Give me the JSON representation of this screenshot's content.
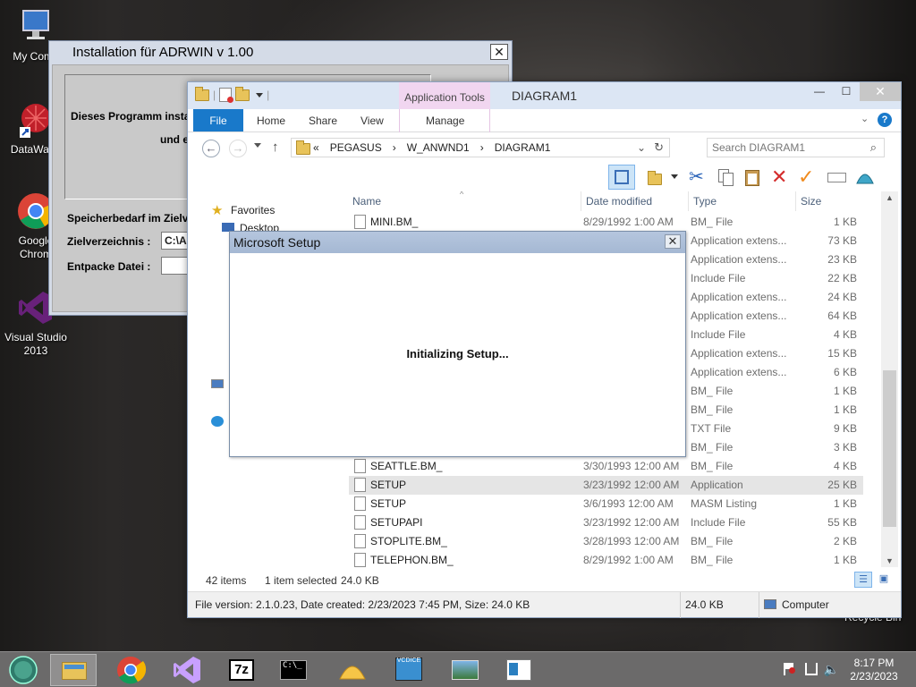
{
  "desktop": {
    "icons": [
      {
        "label": "My Comp",
        "icon": "computer-icon"
      },
      {
        "label": "DataWage",
        "icon": "datawage-shortcut-icon"
      },
      {
        "label": "Google",
        "label2": "Chrom",
        "icon": "chrome-icon"
      },
      {
        "label": "Visual Studio",
        "label2": "2013",
        "icon": "visual-studio-icon"
      }
    ],
    "recycle_bin": "Recycle Bin"
  },
  "adrwin": {
    "title": "Installation für ADRWIN v 1.00",
    "close_glyph": "✕",
    "line1": "Dieses Programm instal",
    "line2": "und e",
    "mem_label": "Speicherbedarf im Zielv",
    "dest_label": "Zielverzeichnis :",
    "dest_value": "C:\\A",
    "unpack_label": "Entpacke Datei :",
    "unpack_value": ""
  },
  "explorer": {
    "title": "DIAGRAM1",
    "context_tab": "Application Tools",
    "context_subtab": "Manage",
    "tabs": [
      "File",
      "Home",
      "Share",
      "View"
    ],
    "breadcrumb": [
      "«",
      "PEGASUS",
      "›",
      "W_ANWND1",
      "›",
      "DIAGRAM1"
    ],
    "search_placeholder": "Search DIAGRAM1",
    "nav": {
      "favorites": "Favorites",
      "desktop": "Desktop"
    },
    "columns": {
      "name": "Name",
      "date": "Date modified",
      "type": "Type",
      "size": "Size"
    },
    "files": [
      {
        "name": "MINI.BM_",
        "date": "8/29/1992 1:00 AM",
        "type": "BM_ File",
        "size": "1 KB"
      },
      {
        "name": "",
        "date": "",
        "type": "Application extens...",
        "size": "73 KB"
      },
      {
        "name": "",
        "date": "",
        "type": "Application extens...",
        "size": "23 KB"
      },
      {
        "name": "",
        "date": "",
        "type": "Include File",
        "size": "22 KB"
      },
      {
        "name": "",
        "date": "",
        "type": "Application extens...",
        "size": "24 KB"
      },
      {
        "name": "",
        "date": "",
        "type": "Application extens...",
        "size": "64 KB"
      },
      {
        "name": "",
        "date": "",
        "type": "Include File",
        "size": "4 KB"
      },
      {
        "name": "",
        "date": "",
        "type": "Application extens...",
        "size": "15 KB"
      },
      {
        "name": "",
        "date": "",
        "type": "Application extens...",
        "size": "6 KB"
      },
      {
        "name": "",
        "date": "",
        "type": "BM_ File",
        "size": "1 KB"
      },
      {
        "name": "",
        "date": "",
        "type": "BM_ File",
        "size": "1 KB"
      },
      {
        "name": "",
        "date": "",
        "type": "TXT File",
        "size": "9 KB"
      },
      {
        "name": "",
        "date": "",
        "type": "BM_ File",
        "size": "3 KB"
      },
      {
        "name": "SEATTLE.BM_",
        "date": "3/30/1993 12:00 AM",
        "type": "BM_ File",
        "size": "4 KB"
      },
      {
        "name": "SETUP",
        "date": "3/23/1992 12:00 AM",
        "type": "Application",
        "size": "25 KB",
        "selected": true
      },
      {
        "name": "SETUP",
        "date": "3/6/1993 12:00 AM",
        "type": "MASM Listing",
        "size": "1 KB"
      },
      {
        "name": "SETUPAPI",
        "date": "3/23/1992 12:00 AM",
        "type": "Include File",
        "size": "55 KB"
      },
      {
        "name": "STOPLITE.BM_",
        "date": "3/28/1993 12:00 AM",
        "type": "BM_ File",
        "size": "2 KB"
      },
      {
        "name": "TELEPHON.BM_",
        "date": "8/29/1992 1:00 AM",
        "type": "BM_ File",
        "size": "1 KB"
      }
    ],
    "status": {
      "items": "42 items",
      "selected": "1 item selected",
      "selected_size": "24.0 KB",
      "file_info": "File version: 2.1.0.23, Date created: 2/23/2023 7:45 PM, Size: 24.0 KB",
      "size": "24.0 KB",
      "location": "Computer"
    }
  },
  "setup_dialog": {
    "title": "Microsoft Setup",
    "close_glyph": "✕",
    "message": "Initializing Setup..."
  },
  "taskbar": {
    "time": "8:17 PM",
    "date": "2/23/2023",
    "apps": [
      "start-orb-icon",
      "file-explorer-icon",
      "chrome-icon",
      "visual-studio-icon",
      "7zip-icon",
      "command-prompt-icon",
      "shell-icon",
      "vcdice-icon",
      "photo-viewer-icon",
      "document-icon"
    ],
    "labels": {
      "seven_zip": "7z",
      "vcdice": "VCDICE"
    }
  },
  "colors": {
    "accent": "#1979ca",
    "context_tab": "#f1d6f0",
    "taskbar": "#6b6a6a"
  }
}
